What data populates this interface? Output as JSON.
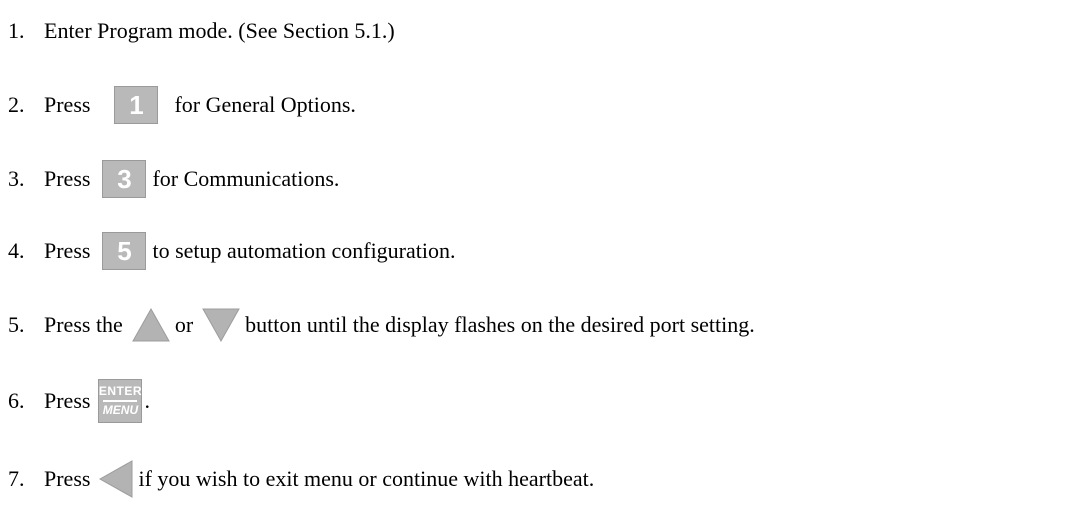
{
  "steps": [
    {
      "number": "1.",
      "text": "Enter Program mode. (See Section 5.1.)"
    },
    {
      "number": "2.",
      "before": "Press",
      "key": "1",
      "after": "for General Options."
    },
    {
      "number": "3.",
      "before": "Press",
      "key": "3",
      "after": "for Communications."
    },
    {
      "number": "4.",
      "before": "Press",
      "key": "5",
      "after": "to setup automation configuration."
    },
    {
      "number": "5.",
      "before": "Press the",
      "middle": "or",
      "after": "button until the display flashes on the desired port setting.",
      "icons": [
        "up-triangle-icon",
        "down-triangle-icon"
      ]
    },
    {
      "number": "6.",
      "before": "Press",
      "after": ".",
      "enter_key": {
        "top": "ENTER",
        "bottom": "MENU"
      }
    },
    {
      "number": "7.",
      "before": "Press",
      "after": "if you wish to exit menu or continue with heartbeat.",
      "icons": [
        "left-triangle-icon"
      ]
    }
  ],
  "colors": {
    "key_fill": "#b9b9b9",
    "key_text": "#ffffff",
    "triangle_fill": "#b3b3b3"
  }
}
